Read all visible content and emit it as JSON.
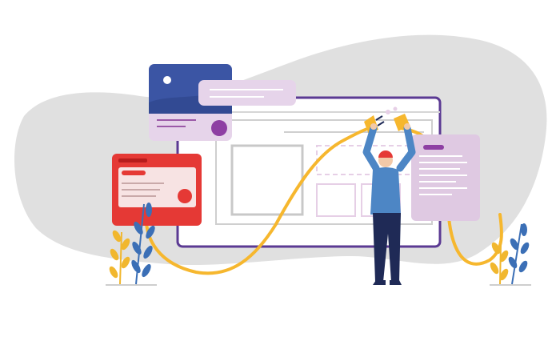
{
  "illustration": {
    "subject": "person-connecting-plug-and-socket-in-front-of-website-wireframe",
    "icons": [
      "plug-icon",
      "socket-icon",
      "browser-window-icon",
      "image-card-icon",
      "chat-bubble-icon",
      "profile-card-icon",
      "document-card-icon",
      "plant-icon"
    ]
  },
  "colors": {
    "blob": "#e0e0e0",
    "frame_purple": "#5b3a93",
    "wire_yellow": "#f6b72e",
    "card_red": "#e53935",
    "card_blue": "#3b55a4",
    "lavender": "#e6d4ea",
    "person_shirt": "#4d86c5",
    "person_pants": "#1f2a56",
    "leaf_blue": "#3b6fb6",
    "leaf_yellow": "#f1b72e"
  }
}
